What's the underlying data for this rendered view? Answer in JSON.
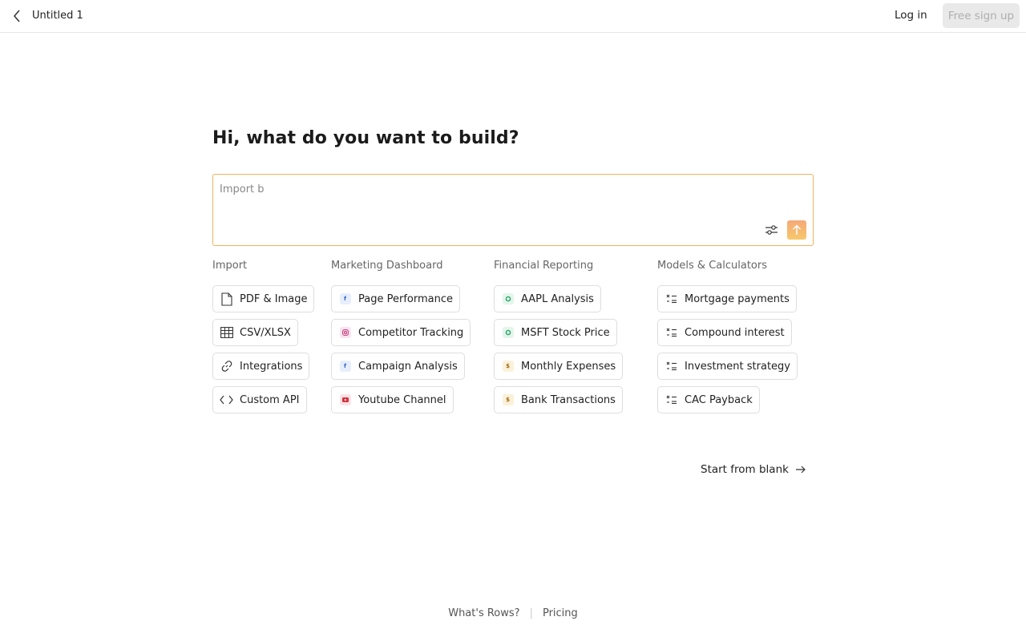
{
  "topbar": {
    "doc_title": "Untitled 1",
    "login_label": "Log in",
    "signup_label": "Free sign up"
  },
  "main": {
    "headline": "Hi, what do you want to build?",
    "prompt": {
      "value": "Import b",
      "placeholder": ""
    },
    "start_blank_label": "Start from blank"
  },
  "columns": [
    {
      "title": "Import",
      "items": [
        {
          "label": "PDF & Image",
          "icon": "file-icon"
        },
        {
          "label": "CSV/XLSX",
          "icon": "table-icon"
        },
        {
          "label": "Integrations",
          "icon": "link-icon"
        },
        {
          "label": "Custom API",
          "icon": "code-icon"
        }
      ]
    },
    {
      "title": "Marketing Dashboard",
      "items": [
        {
          "label": "Page Performance",
          "icon": "facebook-icon"
        },
        {
          "label": "Competitor Tracking",
          "icon": "instagram-icon"
        },
        {
          "label": "Campaign Analysis",
          "icon": "facebook-icon"
        },
        {
          "label": "Youtube Channel",
          "icon": "youtube-icon"
        }
      ]
    },
    {
      "title": "Financial Reporting",
      "items": [
        {
          "label": "AAPL Analysis",
          "icon": "stock-icon"
        },
        {
          "label": "MSFT Stock Price",
          "icon": "stock-icon"
        },
        {
          "label": "Monthly Expenses",
          "icon": "dollar-icon"
        },
        {
          "label": "Bank Transactions",
          "icon": "dollar-icon"
        }
      ]
    },
    {
      "title": "Models & Calculators",
      "items": [
        {
          "label": "Mortgage payments",
          "icon": "calculator-icon"
        },
        {
          "label": "Compound interest",
          "icon": "calculator-icon"
        },
        {
          "label": "Investment strategy",
          "icon": "calculator-icon"
        },
        {
          "label": "CAC Payback",
          "icon": "calculator-icon"
        }
      ]
    }
  ],
  "footer": {
    "whats_rows": "What's Rows?",
    "separator": "|",
    "pricing": "Pricing"
  },
  "colors": {
    "accent_border": "#f0b25e",
    "send_gradient_top": "#f5a97a",
    "send_gradient_bottom": "#f7c86a",
    "signup_bg": "#e9e9e9"
  }
}
